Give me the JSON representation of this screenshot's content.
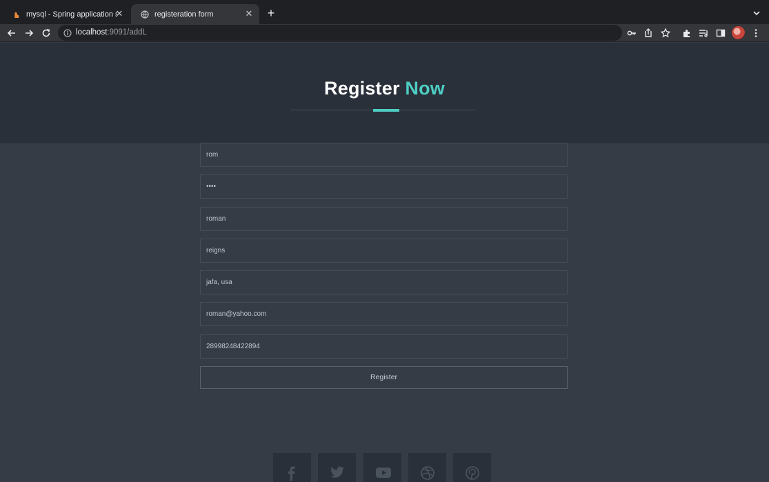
{
  "browser": {
    "tabs": [
      {
        "title": "mysql - Spring application star",
        "favicon": "mysql-favicon",
        "active": false
      },
      {
        "title": "registeration form",
        "favicon": "globe-favicon",
        "active": true
      }
    ],
    "url": {
      "host": "localhost",
      "path": ":9091/addL"
    },
    "toolbar_icons": [
      "key-icon",
      "share-icon",
      "star-icon",
      "extensions-icon",
      "reading-list-icon",
      "side-panel-icon",
      "avatar",
      "menu-icon"
    ]
  },
  "page": {
    "heading": {
      "part1": "Register ",
      "part2": "Now"
    },
    "accent_color": "#4ecdc4",
    "fields": [
      {
        "name": "username",
        "value": "rom"
      },
      {
        "name": "password",
        "value": "••••"
      },
      {
        "name": "first-name",
        "value": "roman"
      },
      {
        "name": "last-name",
        "value": "reigns"
      },
      {
        "name": "address",
        "value": "jafa, usa"
      },
      {
        "name": "email",
        "value": "roman@yahoo.com"
      },
      {
        "name": "phone",
        "value": "28998248422894"
      }
    ],
    "register_label": "Register",
    "social_icons": [
      "facebook-icon",
      "twitter-icon",
      "youtube-icon",
      "dribbble-icon",
      "pinterest-icon"
    ]
  }
}
